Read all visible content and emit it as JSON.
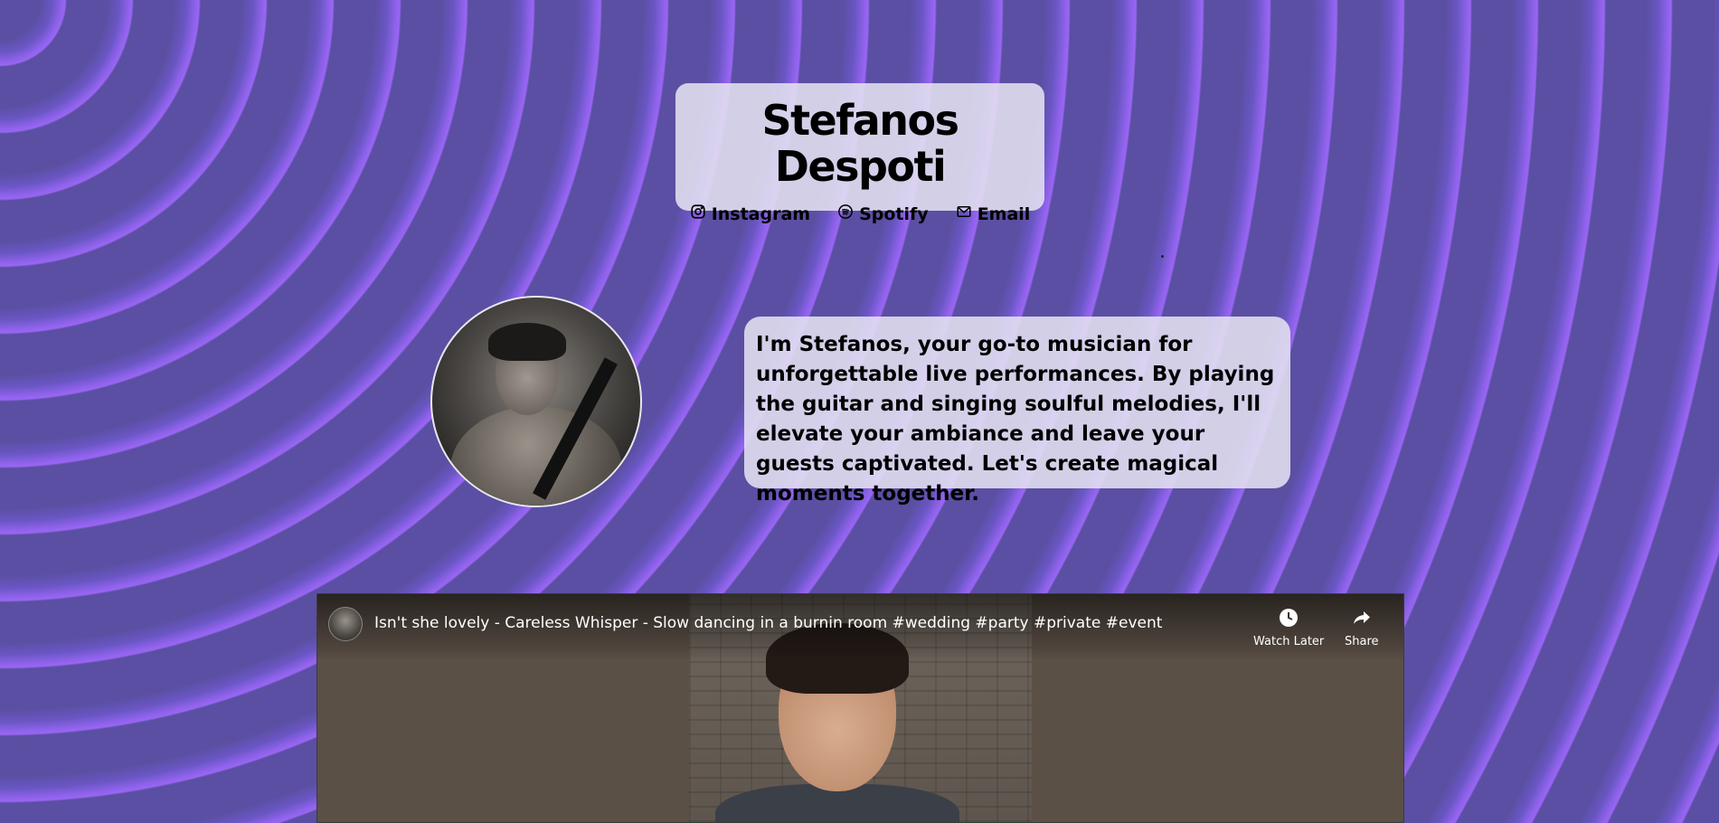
{
  "header": {
    "title": "Stefanos Despoti",
    "links": [
      {
        "label": "Instagram",
        "icon": "instagram-icon"
      },
      {
        "label": "Spotify",
        "icon": "spotify-icon"
      },
      {
        "label": "Email",
        "icon": "mail-icon"
      }
    ]
  },
  "bio": {
    "text": "I'm Stefanos, your go-to musician for unforgettable live performances. By playing the guitar and singing soulful melodies, I'll elevate your ambiance and leave your guests captivated. Let's create magical moments together."
  },
  "video": {
    "title": "Isn't she lovely - Careless Whisper - Slow dancing in a burnin room #wedding #party #private #event",
    "watch_later_label": "Watch Later",
    "share_label": "Share"
  },
  "colors": {
    "background": "#5a4fa2",
    "ring_highlight": "#9a66f4",
    "card": "#e4e1f0"
  }
}
